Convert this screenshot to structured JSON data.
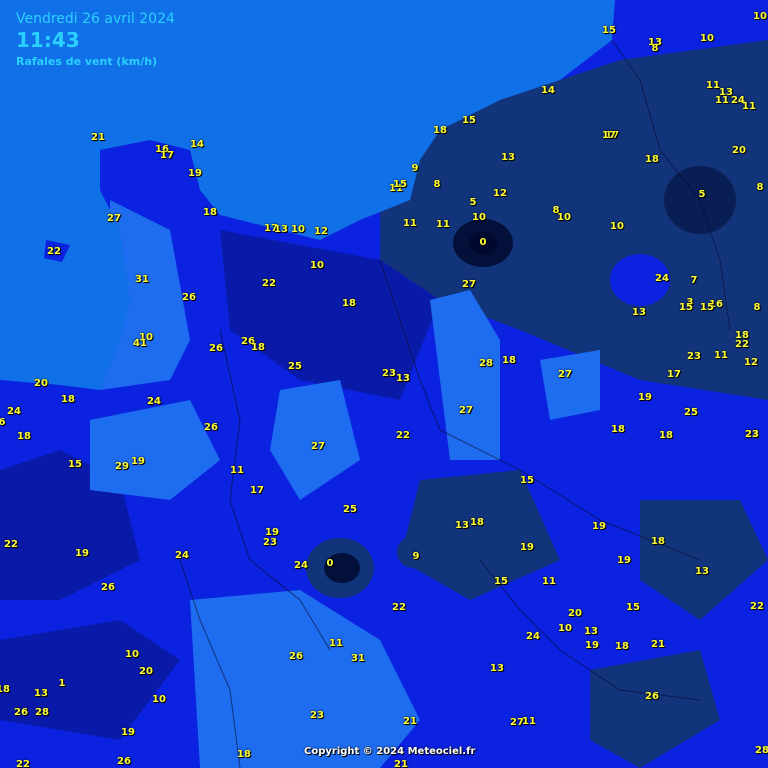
{
  "header": {
    "date": "Vendredi 26 avril 2024",
    "time": "11:43",
    "parameter": "Rafales de vent (km/h)"
  },
  "copyright": "Copyright © 2024 Meteociel.fr",
  "colors": {
    "sea": "#1070e8",
    "gust_0_9": "#02103a",
    "gust_10_14": "#12347a",
    "gust_15_19": "#0a1aa8",
    "gust_20_24": "#0b22e0",
    "gust_25_plus": "#1e6df0",
    "label": "#ffff33",
    "header_text": "#2ad0ff"
  },
  "map_type": "wind gust station map, northern France / English Channel",
  "stations": [
    "15",
    "13",
    "8",
    "10",
    "10",
    "17",
    "11",
    "13",
    "24",
    "11",
    "11",
    "14",
    "15",
    "18",
    "17",
    "18",
    "20",
    "13",
    "9",
    "8",
    "11",
    "15",
    "5",
    "12",
    "5",
    "8",
    "10",
    "8",
    "10",
    "0",
    "10",
    "11",
    "24",
    "7",
    "3",
    "15",
    "16",
    "15",
    "13",
    "18",
    "22",
    "8",
    "11",
    "23",
    "12",
    "17",
    "19",
    "25",
    "27",
    "22",
    "18",
    "23",
    "21",
    "16",
    "17",
    "14",
    "19",
    "18",
    "27",
    "22",
    "17",
    "13",
    "10",
    "12",
    "11",
    "10",
    "22",
    "18",
    "26",
    "27",
    "31",
    "10",
    "41",
    "26",
    "26",
    "18",
    "25",
    "23",
    "13",
    "28",
    "18",
    "27",
    "20",
    "24",
    "18",
    "24",
    "6",
    "18",
    "26",
    "27",
    "22",
    "18",
    "15",
    "29",
    "19",
    "11",
    "17",
    "15",
    "25",
    "13",
    "18",
    "19",
    "22",
    "19",
    "24",
    "19",
    "23",
    "24",
    "0",
    "9",
    "15",
    "11",
    "19",
    "18",
    "13",
    "19",
    "26",
    "15",
    "20",
    "10",
    "13",
    "22",
    "22",
    "24",
    "21",
    "19",
    "18",
    "10",
    "26",
    "11",
    "31",
    "20",
    "13",
    "1",
    "18",
    "13",
    "26",
    "10",
    "26",
    "28",
    "23",
    "21",
    "27",
    "11",
    "19",
    "28",
    "18",
    "22",
    "26",
    "21"
  ]
}
